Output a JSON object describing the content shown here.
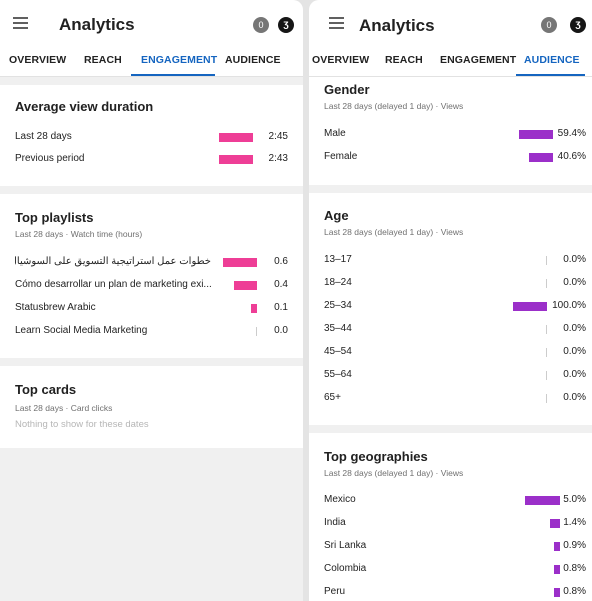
{
  "left": {
    "app_title": "Analytics",
    "notif_count": "0",
    "avatar_glyph": "ʒ",
    "tabs": [
      "OVERVIEW",
      "REACH",
      "ENGAGEMENT",
      "AUDIENCE"
    ],
    "active_tab": "ENGAGEMENT",
    "avg_view": {
      "title": "Average view duration",
      "rows": [
        {
          "label": "Last 28 days",
          "value": "2:45",
          "fraction": 1.0
        },
        {
          "label": "Previous period",
          "value": "2:43",
          "fraction": 0.99
        }
      ]
    },
    "playlists": {
      "title": "Top playlists",
      "subtitle": "Last 28 days · Watch time (hours)",
      "rows": [
        {
          "label": "خطوات عمل استراتيجية التسويق على السوشيال ميديا...",
          "value": "0.6",
          "fraction": 1.0
        },
        {
          "label": "Cómo desarrollar un plan de marketing exi...",
          "value": "0.4",
          "fraction": 0.67
        },
        {
          "label": "Statusbrew Arabic",
          "value": "0.1",
          "fraction": 0.17
        },
        {
          "label": "Learn Social Media Marketing",
          "value": "0.0",
          "fraction": 0.0
        }
      ]
    },
    "cards": {
      "title": "Top cards",
      "subtitle": "Last 28 days · Card clicks",
      "empty": "Nothing to show for these dates"
    },
    "bar_color": "#ee3e96"
  },
  "right": {
    "app_title": "Analytics",
    "notif_count": "0",
    "avatar_glyph": "ʒ",
    "tabs": [
      "OVERVIEW",
      "REACH",
      "ENGAGEMENT",
      "AUDIENCE"
    ],
    "active_tab": "AUDIENCE",
    "gender": {
      "title": "Gender",
      "subtitle": "Last 28 days (delayed 1 day) · Views",
      "rows": [
        {
          "label": "Male",
          "value": "59.4%",
          "fraction": 0.594
        },
        {
          "label": "Female",
          "value": "40.6%",
          "fraction": 0.406
        }
      ]
    },
    "age": {
      "title": "Age",
      "subtitle": "Last 28 days (delayed 1 day) · Views",
      "rows": [
        {
          "label": "13–17",
          "value": "0.0%",
          "fraction": 0.0
        },
        {
          "label": "18–24",
          "value": "0.0%",
          "fraction": 0.0
        },
        {
          "label": "25–34",
          "value": "100.0%",
          "fraction": 1.0
        },
        {
          "label": "35–44",
          "value": "0.0%",
          "fraction": 0.0
        },
        {
          "label": "45–54",
          "value": "0.0%",
          "fraction": 0.0
        },
        {
          "label": "55–64",
          "value": "0.0%",
          "fraction": 0.0
        },
        {
          "label": "65+",
          "value": "0.0%",
          "fraction": 0.0
        }
      ]
    },
    "geo": {
      "title": "Top geographies",
      "subtitle": "Last 28 days (delayed 1 day) · Views",
      "rows": [
        {
          "label": "Mexico",
          "value": "5.0%",
          "fraction": 0.05
        },
        {
          "label": "India",
          "value": "1.4%",
          "fraction": 0.014
        },
        {
          "label": "Sri Lanka",
          "value": "0.9%",
          "fraction": 0.009
        },
        {
          "label": "Colombia",
          "value": "0.8%",
          "fraction": 0.008
        },
        {
          "label": "Peru",
          "value": "0.8%",
          "fraction": 0.008
        }
      ]
    },
    "bar_color": "#9b2fc9"
  }
}
